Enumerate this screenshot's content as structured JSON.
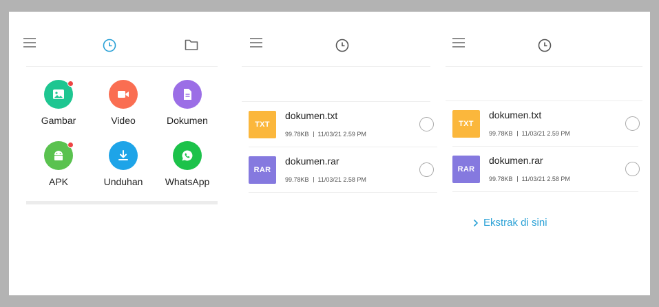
{
  "colors": {
    "accent": "#2aa1d6",
    "gambar": "#1ec691",
    "video": "#fa6e52",
    "dokumen": "#9b6ee6",
    "apk": "#5ac24f",
    "unduhan": "#1ea4e8",
    "whatsapp": "#1cc24a",
    "txt": "#fbb73c",
    "rar": "#8579df",
    "badge": "#ee4444"
  },
  "panel1": {
    "toolbar": {
      "icons": [
        "menu-icon",
        "clock-icon",
        "folder-icon"
      ]
    },
    "categories": [
      {
        "label": "Gambar",
        "icon": "image-icon",
        "badge": true
      },
      {
        "label": "Video",
        "icon": "video-camera-icon",
        "badge": false
      },
      {
        "label": "Dokumen",
        "icon": "document-icon",
        "badge": false
      },
      {
        "label": "APK",
        "icon": "android-icon",
        "badge": true
      },
      {
        "label": "Unduhan",
        "icon": "download-icon",
        "badge": false
      },
      {
        "label": "WhatsApp",
        "icon": "whatsapp-icon",
        "badge": false
      }
    ]
  },
  "panel2": {
    "toolbar": {
      "icons": [
        "menu-icon",
        "clock-icon"
      ]
    },
    "files": [
      {
        "type": "TXT",
        "name": "dokumen.txt",
        "size": "99.78KB",
        "date": "11/03/21 2.59 PM"
      },
      {
        "type": "RAR",
        "name": "dokumen.rar",
        "size": "99.78KB",
        "date": "11/03/21 2.58 PM"
      }
    ]
  },
  "panel3": {
    "toolbar": {
      "icons": [
        "menu-icon",
        "clock-icon"
      ]
    },
    "files": [
      {
        "type": "TXT",
        "name": "dokumen.txt",
        "size": "99.78KB",
        "date": "11/03/21 2.59 PM"
      },
      {
        "type": "RAR",
        "name": "dokumen.rar",
        "size": "99.78KB",
        "date": "11/03/21 2.58 PM"
      }
    ],
    "extract_label": "Ekstrak di sini"
  }
}
